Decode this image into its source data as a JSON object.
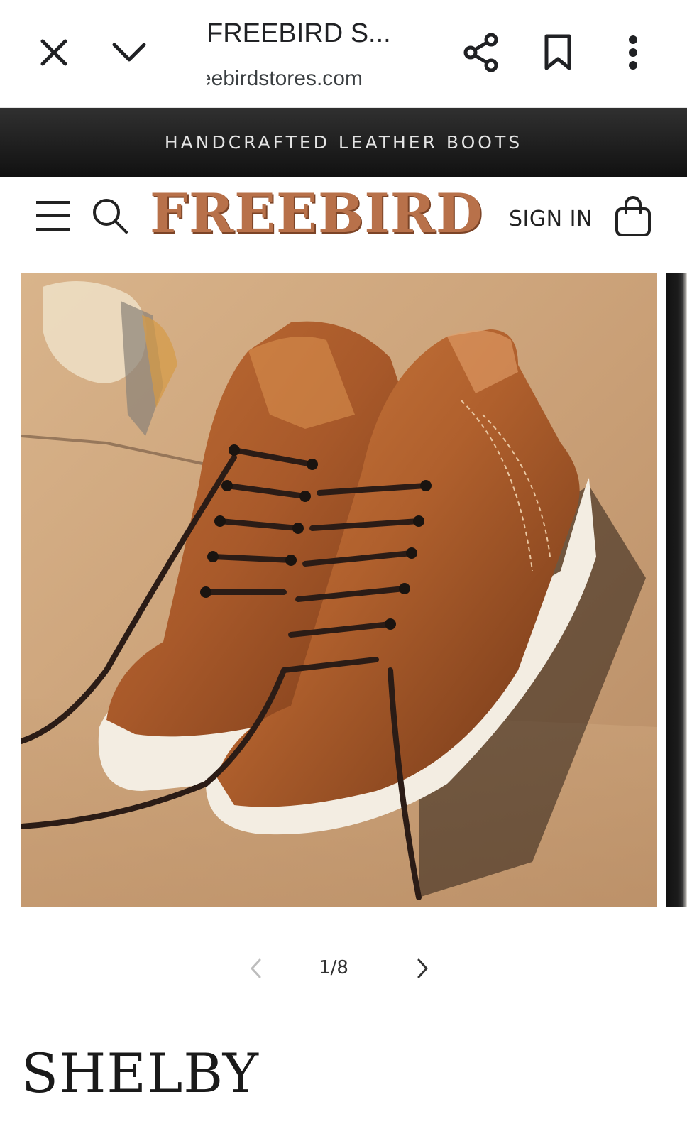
{
  "browser": {
    "title": "FREEBIRD S...",
    "url": "freebirdstores.com"
  },
  "announcement": {
    "text": "HANDCRAFTED LEATHER BOOTS"
  },
  "header": {
    "logo_text": "FREEBIRD",
    "sign_in_label": "SIGN IN"
  },
  "gallery": {
    "image_description": "Tan leather lace-up high-top sneakers with white soles leaning against a concrete wall",
    "counter": "1/8",
    "current": 1,
    "total": 8
  },
  "product": {
    "title": "SHELBY"
  },
  "colors": {
    "banner_bg": "#1b1b1b",
    "logo": "#b8714a",
    "leather": "#a8592a",
    "sole": "#f3ede2"
  },
  "icons": [
    "close-icon",
    "chevron-down-icon",
    "share-icon",
    "bookmark-icon",
    "more-vert-icon",
    "menu-icon",
    "search-icon",
    "shopping-bag-icon",
    "chevron-left-icon",
    "chevron-right-icon"
  ]
}
